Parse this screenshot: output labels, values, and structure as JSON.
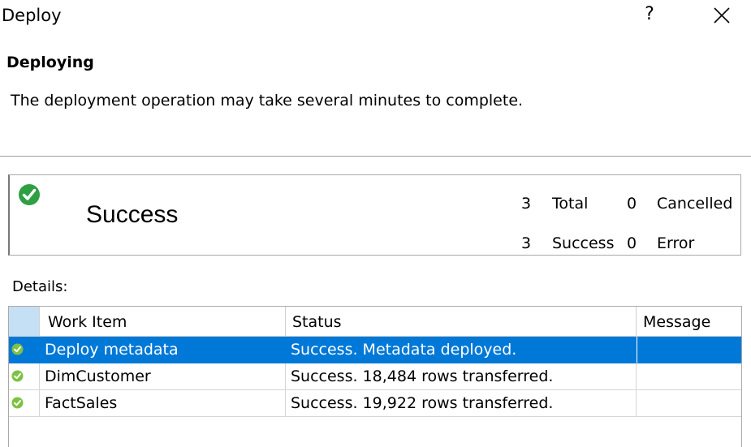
{
  "window": {
    "title": "Deploy",
    "help_label": "?"
  },
  "header": {
    "heading": "Deploying",
    "description": "The deployment operation may take several minutes to complete."
  },
  "summary": {
    "status": "Success",
    "total_count": "3",
    "total_label": "Total",
    "cancelled_count": "0",
    "cancelled_label": "Cancelled",
    "success_count": "3",
    "success_label": "Success",
    "error_count": "0",
    "error_label": "Error"
  },
  "details": {
    "label": "Details:",
    "columns": [
      "Work Item",
      "Status",
      "Message"
    ],
    "rows": [
      {
        "work_item": "Deploy metadata",
        "status": "Success. Metadata deployed.",
        "message": "",
        "selected": true
      },
      {
        "work_item": "DimCustomer",
        "status": "Success. 18,484 rows transferred.",
        "message": "",
        "selected": false
      },
      {
        "work_item": "FactSales",
        "status": "Success. 19,922 rows transferred.",
        "message": "",
        "selected": false
      }
    ]
  },
  "colors": {
    "success_green": "#2ea043",
    "selection_blue": "#0078d7",
    "header_select": "#c5dff4"
  },
  "icons": {
    "help": "question-mark-icon",
    "close": "close-icon",
    "status": "success-check-icon"
  }
}
